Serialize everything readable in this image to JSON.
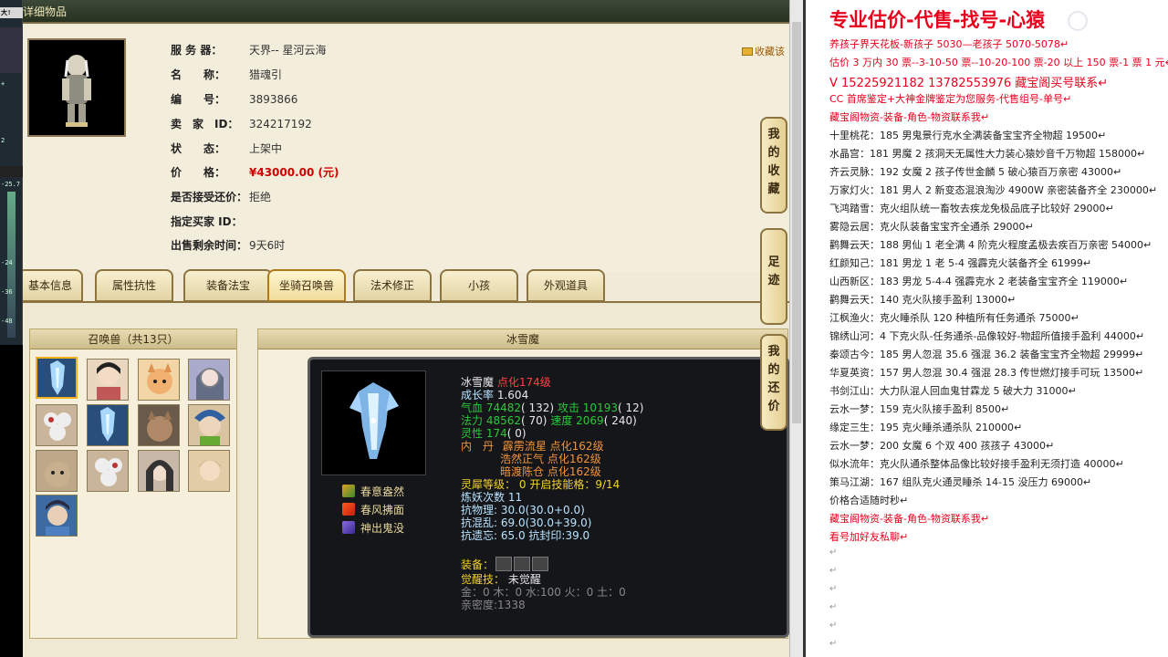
{
  "window": {
    "title": "详细物品"
  },
  "left_strip": {
    "labels": [
      "大!",
      "+",
      "2",
      "-25.7",
      "-24",
      "-36",
      "-48"
    ]
  },
  "item_info": {
    "rows": [
      {
        "label": "服 务 器：",
        "value": "天界-- 星河云海"
      },
      {
        "label": "名　　称：",
        "value": "猎魂引"
      },
      {
        "label": "编　　号：",
        "value": "3893866"
      },
      {
        "label": "卖　家　ID：",
        "value": "324217192"
      },
      {
        "label": "状　　态：",
        "value": "上架中"
      },
      {
        "label": "价　　格：",
        "value": "¥43000.00 (元)"
      },
      {
        "label": "是否接受还价：",
        "value": "拒绝"
      },
      {
        "label": "指定买家 ID：",
        "value": ""
      },
      {
        "label": "出售剩余时间：",
        "value": "9天6时"
      }
    ],
    "favorite_link": "收藏该"
  },
  "tabs": [
    "基本信息",
    "属性抗性",
    "装备法宝",
    "坐骑召唤兽",
    "法术修正",
    "小孩",
    "外观道具"
  ],
  "active_tab": "坐骑召唤兽",
  "side_buttons": [
    {
      "label": [
        "我",
        "的",
        "收",
        "藏"
      ]
    },
    {
      "label": [
        "足",
        "迹"
      ]
    },
    {
      "label": [
        "我",
        "的",
        "还",
        "价"
      ]
    }
  ],
  "pets_panel": {
    "title": "召唤兽（共13只）",
    "count": 13
  },
  "detail_panel": {
    "title": "冰雪魔",
    "name": "冰雪魔",
    "level": "点化174级",
    "growth_label": "成长率",
    "growth": "1.604",
    "hp_label": "气血",
    "hp": "74482",
    "hp_q": "( 132)",
    "atk_label": "攻击",
    "atk": "10193",
    "atk_q": "( 12)",
    "mp_label": "法力",
    "mp": "48562",
    "mp_q": "( 70)",
    "spd_label": "速度",
    "spd": "2069",
    "spd_q": "( 240)",
    "luck_label": "灵性",
    "luck": "174",
    "luck_q": "( 0)",
    "neidan_label": "内　丹",
    "neidan": [
      "霹雳流星 点化162级",
      "浩然正气 点化162级",
      "暗渡陈仓 点化162级"
    ],
    "spirit_label": "灵犀等级：",
    "spirit": "0",
    "spirit_extra": "开启技能格：9/14",
    "refine_label": "炼妖次数",
    "refine": "11",
    "res_phys_label": "抗物理:",
    "res_phys": "30.0(30.0+0.0)",
    "res_chaos_label": "抗混乱:",
    "res_chaos": "69.0(30.0+39.0)",
    "res_forget_label": "抗遗忘:",
    "res_forget": "65.0",
    "res_seal_label": "抗封印:",
    "res_seal": "39.0",
    "equip_label": "装备：",
    "awaken_label": "觉醒技：",
    "awaken": "未觉醒",
    "elements": "金：0  木：0  水:100  火：0  土：0",
    "intimacy_label": "亲密度:",
    "intimacy": "1338",
    "skills": [
      "春意盎然",
      "春风拂面",
      "神出鬼没"
    ]
  },
  "doc": {
    "title": "专业估价-代售-找号-心猿",
    "lines": [
      {
        "text": "养孩子界天花板-新孩子 5030—老孩子 5070-5078↵",
        "style": "red"
      },
      {
        "text": "估价 3 万内 30 票--3-10-50 票--10-20-100 票-20 以上 150 票-1 票 1 元↵",
        "style": "red"
      },
      {
        "text": "V 15225921182      13782553976    藏宝阁买号联系↵",
        "style": "red mid"
      },
      {
        "text": "CC 首席鉴定+大神金牌鉴定为您服务-代售组号-单号↵",
        "style": "red"
      },
      {
        "text": "藏宝阁物资-装备-角色-物资联系我↵",
        "style": "red"
      },
      {
        "text": "十里桃花：185 男鬼景行克水全满装备宝宝齐全物超 19500↵",
        "style": ""
      },
      {
        "text": "水晶宫：181 男魔 2 孩洞天无属性大力装心猿妙音千万物超 158000↵",
        "style": ""
      },
      {
        "text": "齐云灵脉：192 女魔 2 孩子传世金麟 5 破心猿百万亲密 43000↵",
        "style": ""
      },
      {
        "text": "万家灯火：181 男人 2 新变态混浪淘沙 4900W 亲密装备齐全 230000↵",
        "style": ""
      },
      {
        "text": "飞鸿踏雪：克火组队统一畜牧去疾龙免极品底子比较好 29000↵",
        "style": ""
      },
      {
        "text": "雾隐云居：克火队装备宝宝齐全通杀 29000↵",
        "style": ""
      },
      {
        "text": "鹳舞云天：188 男仙 1 老全满 4 阶克火程度孟极去疾百万亲密 54000↵",
        "style": ""
      },
      {
        "text": "红颜知己：181 男龙 1 老 5-4 强霹克火装备齐全 61999↵",
        "style": ""
      },
      {
        "text": "山西新区：183 男龙 5-4-4 强霹克水 2 老装备宝宝齐全 119000↵",
        "style": ""
      },
      {
        "text": "鹳舞云天：140 克火队接手盈利 13000↵",
        "style": ""
      },
      {
        "text": "江枫渔火：克火睡杀队 120 种植所有任务通杀 75000↵",
        "style": ""
      },
      {
        "text": "锦绣山河：4 下克火队-任务通杀-品像较好-物超所值接手盈利 44000↵",
        "style": ""
      },
      {
        "text": "秦颂古今：185 男人忽混 35.6 强混 36.2 装备宝宝齐全物超 29999↵",
        "style": ""
      },
      {
        "text": "华夏英资：157 男人忽混 30.4 强混 28.3 传世燃灯接手可玩 13500↵",
        "style": ""
      },
      {
        "text": "书剑江山：大力队混人回血鬼甘霖龙 5 破大力 31000↵",
        "style": ""
      },
      {
        "text": "云水一梦：159 克火队接手盈利 8500↵",
        "style": ""
      },
      {
        "text": "缘定三生：195 克火睡杀通杀队 210000↵",
        "style": ""
      },
      {
        "text": "云水一梦：200 女魔 6 个双 400 孩孩子 43000↵",
        "style": ""
      },
      {
        "text": "似水流年：克火队通杀整体品像比较好接手盈利无须打造 40000↵",
        "style": ""
      },
      {
        "text": "策马江湖：167 组队克火通灵睡杀 14-15 没压力 69000↵",
        "style": ""
      },
      {
        "text": "价格合适随时秒↵",
        "style": ""
      },
      {
        "text": "藏宝阁物资-装备-角色-物资联系我↵",
        "style": "red"
      },
      {
        "text": "看号加好友私聊↵",
        "style": "red"
      },
      {
        "text": "↵",
        "style": "gray"
      },
      {
        "text": "↵",
        "style": "gray"
      },
      {
        "text": "↵",
        "style": "gray"
      },
      {
        "text": "↵",
        "style": "gray"
      },
      {
        "text": "↵",
        "style": "gray"
      },
      {
        "text": "↵",
        "style": "gray"
      }
    ]
  },
  "watermark": "CC直播"
}
